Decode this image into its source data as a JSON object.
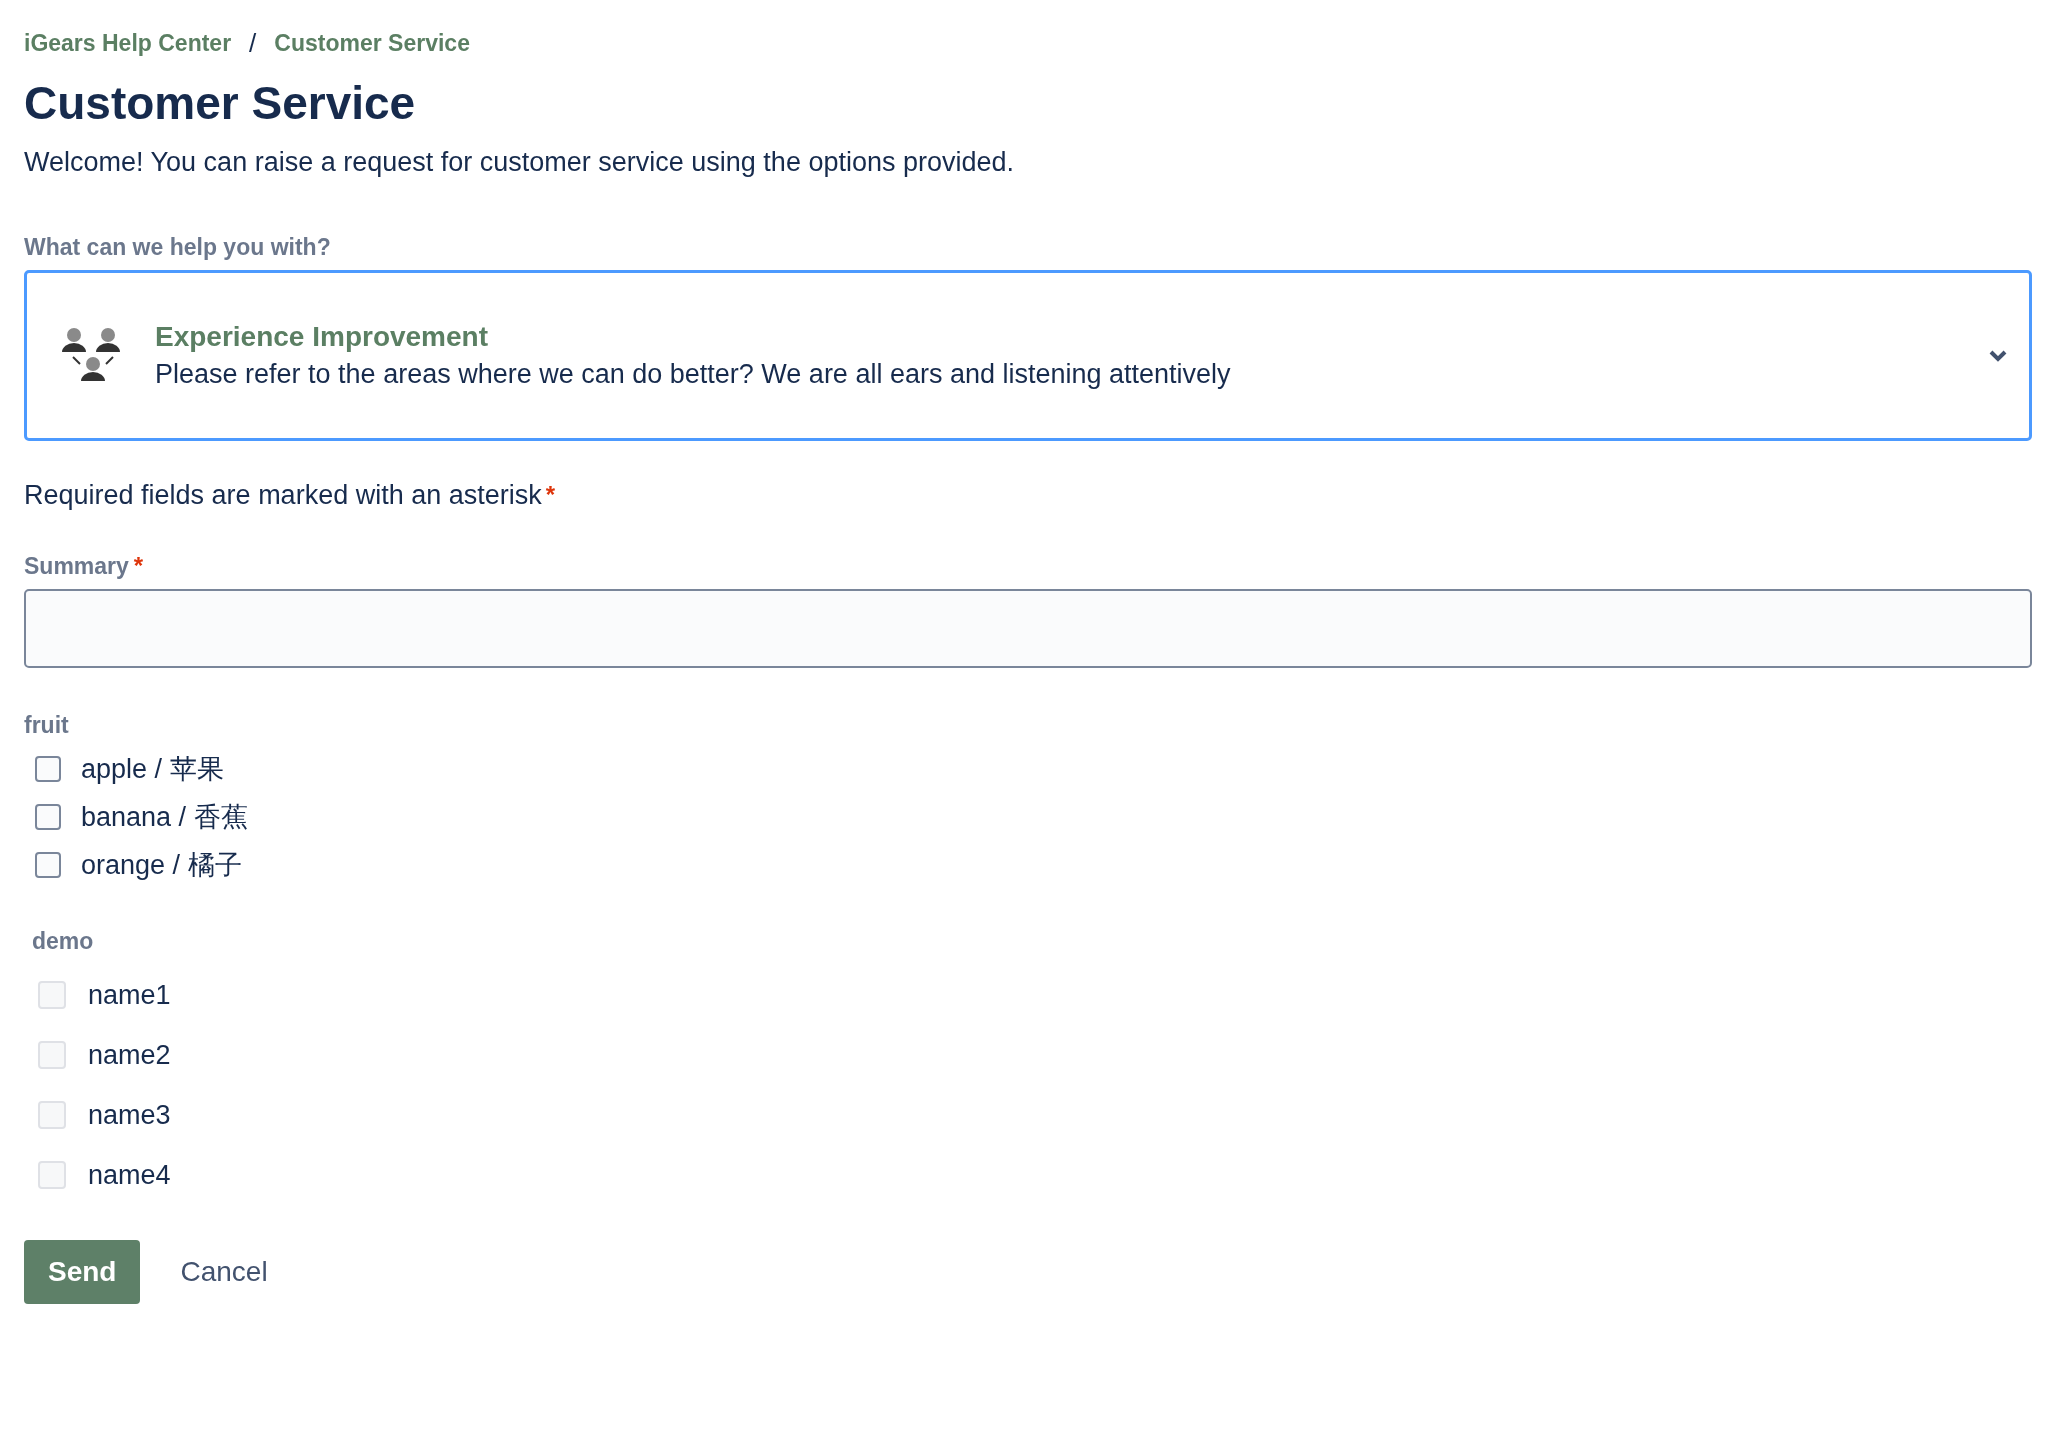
{
  "breadcrumbs": [
    {
      "label": "iGears Help Center"
    },
    {
      "label": "Customer Service"
    }
  ],
  "breadcrumb_separator": "/",
  "title": "Customer Service",
  "intro": "Welcome! You can raise a request for customer service using the options provided.",
  "request_type": {
    "label": "What can we help you with?",
    "name": "Experience Improvement",
    "description": "Please refer to the areas where we can do better? We are all ears and listening attentively",
    "focused": true
  },
  "required_note": {
    "text": "Required fields are marked with an asterisk",
    "mark": "*"
  },
  "summary": {
    "label": "Summary",
    "required_mark": "*"
  },
  "checkbox_groups": [
    {
      "label": "fruit",
      "kind": "outlined",
      "options": [
        {
          "label": "apple / 苹果",
          "checked": false
        },
        {
          "label": "banana / 香蕉",
          "checked": false
        },
        {
          "label": "orange / 橘子",
          "checked": false
        }
      ]
    },
    {
      "label": "demo",
      "kind": "faint",
      "options": [
        {
          "label": "name1",
          "checked": false
        },
        {
          "label": "name2",
          "checked": false
        },
        {
          "label": "name3",
          "checked": false
        },
        {
          "label": "name4",
          "checked": false
        }
      ]
    }
  ],
  "buttons": [
    {
      "label": "Send",
      "kind": "primary"
    },
    {
      "label": "Cancel",
      "kind": "subtle"
    }
  ]
}
